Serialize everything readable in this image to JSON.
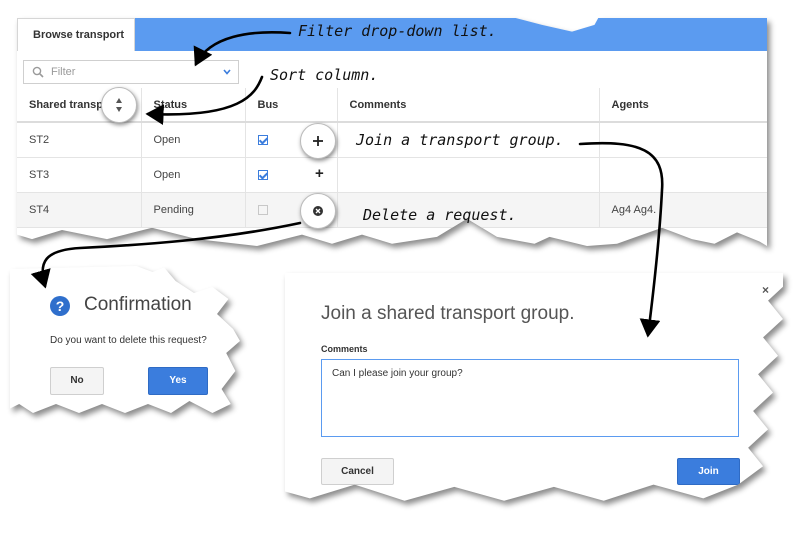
{
  "grid": {
    "tab_label": "Browse transport",
    "filter_placeholder": "Filter",
    "columns": [
      "Shared transport",
      "Status",
      "Bus",
      "Comments",
      "Agents"
    ],
    "rows": [
      {
        "transport": "ST2",
        "status": "Open",
        "bus": true,
        "comments": "",
        "agents": ""
      },
      {
        "transport": "ST3",
        "status": "Open",
        "bus": true,
        "comments": "",
        "agents": ""
      },
      {
        "transport": "ST4",
        "status": "Pending",
        "bus": false,
        "comments": "",
        "agents": "Ag4 Ag4."
      }
    ],
    "join_symbol": "+"
  },
  "callouts": {
    "filter": "Filter drop-down list.",
    "sort": "Sort column.",
    "join": "Join a transport group.",
    "delete": "Delete a request."
  },
  "confirmation": {
    "icon": "?",
    "title": "Confirmation",
    "message": "Do you want to delete this request?",
    "no_label": "No",
    "yes_label": "Yes"
  },
  "join_dialog": {
    "title": "Join a shared transport group.",
    "close_symbol": "×",
    "comments_label": "Comments",
    "comments_value": "Can I please join your group?",
    "cancel_label": "Cancel",
    "join_label": "Join"
  },
  "colors": {
    "accent": "#5b9bf0",
    "button_blue": "#3b7ddd",
    "help_icon": "#2f6fcc"
  }
}
